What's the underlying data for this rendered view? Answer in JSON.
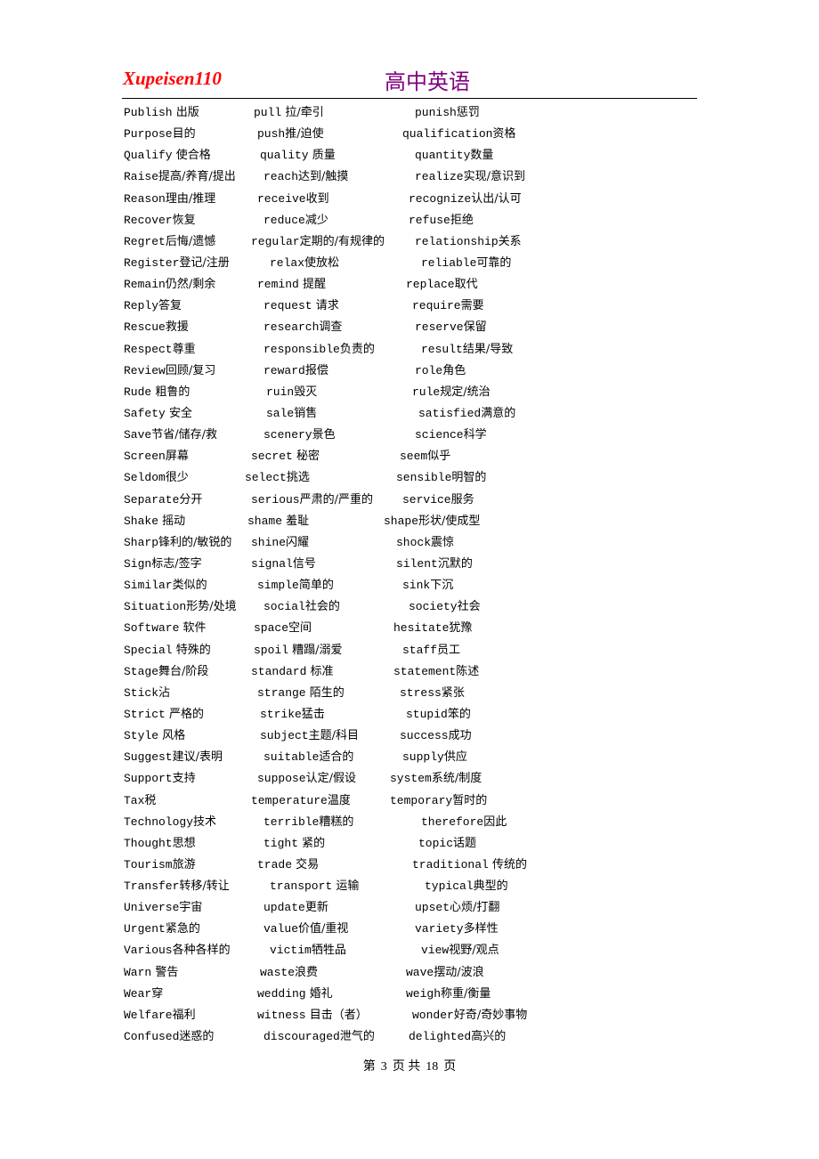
{
  "header": {
    "left_title": "Xupeisen110",
    "center_title": "高中英语"
  },
  "colors": {
    "left_title": "#ff0000",
    "center_title": "#800080",
    "text": "#000000"
  },
  "vocabulary_rows": [
    [
      {
        "en": "Publish",
        "cn": " 出版"
      },
      {
        "en": "pull",
        "cn": " 拉/牵引"
      },
      {
        "en": "punish",
        "cn": "惩罚"
      }
    ],
    [
      {
        "en": "Purpose",
        "cn": "目的"
      },
      {
        "en": "push",
        "cn": "推/迫使"
      },
      {
        "en": "qualification",
        "cn": "资格"
      }
    ],
    [
      {
        "en": "Qualify",
        "cn": " 使合格"
      },
      {
        "en": "quality",
        "cn": " 质量"
      },
      {
        "en": "quantity",
        "cn": "数量"
      }
    ],
    [
      {
        "en": "Raise",
        "cn": "提高/养育/提出"
      },
      {
        "en": "reach",
        "cn": "达到/触摸"
      },
      {
        "en": "realize",
        "cn": "实现/意识到"
      }
    ],
    [
      {
        "en": "Reason",
        "cn": "理由/推理"
      },
      {
        "en": "receive",
        "cn": "收到"
      },
      {
        "en": "recognize",
        "cn": "认出/认可"
      }
    ],
    [
      {
        "en": "Recover",
        "cn": "恢复"
      },
      {
        "en": "reduce",
        "cn": "减少"
      },
      {
        "en": "refuse",
        "cn": "拒绝"
      }
    ],
    [
      {
        "en": "Regret",
        "cn": "后悔/遗憾"
      },
      {
        "en": "regular",
        "cn": "定期的/有规律的"
      },
      {
        "en": "relationship",
        "cn": "关系"
      }
    ],
    [
      {
        "en": "Register",
        "cn": "登记/注册"
      },
      {
        "en": "relax",
        "cn": "使放松"
      },
      {
        "en": "reliable",
        "cn": "可靠的"
      }
    ],
    [
      {
        "en": "Remain",
        "cn": "仍然/剩余"
      },
      {
        "en": "remind",
        "cn": " 提醒"
      },
      {
        "en": "replace",
        "cn": "取代"
      }
    ],
    [
      {
        "en": "Reply",
        "cn": "答复"
      },
      {
        "en": "request",
        "cn": " 请求"
      },
      {
        "en": "require",
        "cn": "需要"
      }
    ],
    [
      {
        "en": "Rescue",
        "cn": "救援"
      },
      {
        "en": "research",
        "cn": "调查"
      },
      {
        "en": "reserve",
        "cn": "保留"
      }
    ],
    [
      {
        "en": "Respect",
        "cn": "尊重"
      },
      {
        "en": "responsible",
        "cn": "负责的"
      },
      {
        "en": "result",
        "cn": "结果/导致"
      }
    ],
    [
      {
        "en": "Review",
        "cn": "回顾/复习"
      },
      {
        "en": "reward",
        "cn": "报偿"
      },
      {
        "en": "role",
        "cn": "角色"
      }
    ],
    [
      {
        "en": "Rude",
        "cn": " 粗鲁的"
      },
      {
        "en": "ruin",
        "cn": "毁灭"
      },
      {
        "en": "rule",
        "cn": "规定/统治"
      }
    ],
    [
      {
        "en": "Safety",
        "cn": " 安全"
      },
      {
        "en": "sale",
        "cn": "销售"
      },
      {
        "en": "satisfied",
        "cn": "满意的"
      }
    ],
    [
      {
        "en": "Save",
        "cn": "节省/储存/救"
      },
      {
        "en": "scenery",
        "cn": "景色"
      },
      {
        "en": "science",
        "cn": "科学"
      }
    ],
    [
      {
        "en": "Screen",
        "cn": "屏幕"
      },
      {
        "en": "secret",
        "cn": " 秘密"
      },
      {
        "en": "seem",
        "cn": "似乎"
      }
    ],
    [
      {
        "en": "Seldom",
        "cn": "很少"
      },
      {
        "en": "select",
        "cn": "挑选"
      },
      {
        "en": "sensible",
        "cn": "明智的"
      }
    ],
    [
      {
        "en": "Separate",
        "cn": "分开"
      },
      {
        "en": "serious",
        "cn": "严肃的/严重的"
      },
      {
        "en": "service",
        "cn": "服务"
      }
    ],
    [
      {
        "en": "Shake",
        "cn": " 摇动"
      },
      {
        "en": "shame",
        "cn": " 羞耻"
      },
      {
        "en": "shape",
        "cn": "形状/使成型"
      }
    ],
    [
      {
        "en": "Sharp",
        "cn": "锋利的/敏锐的"
      },
      {
        "en": "shine",
        "cn": "闪耀"
      },
      {
        "en": "shock",
        "cn": "震惊"
      }
    ],
    [
      {
        "en": "Sign",
        "cn": "标志/签字"
      },
      {
        "en": "signal",
        "cn": "信号"
      },
      {
        "en": "silent",
        "cn": "沉默的"
      }
    ],
    [
      {
        "en": "Similar",
        "cn": "类似的"
      },
      {
        "en": "simple",
        "cn": "简单的"
      },
      {
        "en": "sink",
        "cn": "下沉"
      }
    ],
    [
      {
        "en": "Situation",
        "cn": "形势/处境"
      },
      {
        "en": "social",
        "cn": "社会的"
      },
      {
        "en": "society",
        "cn": "社会"
      }
    ],
    [
      {
        "en": "Software",
        "cn": " 软件"
      },
      {
        "en": "space",
        "cn": "空间"
      },
      {
        "en": "hesitate",
        "cn": "犹豫"
      }
    ],
    [
      {
        "en": "Special",
        "cn": " 特殊的"
      },
      {
        "en": "spoil",
        "cn": " 糟蹋/溺爱"
      },
      {
        "en": "staff",
        "cn": "员工"
      }
    ],
    [
      {
        "en": "Stage",
        "cn": "舞台/阶段"
      },
      {
        "en": "standard",
        "cn": " 标准"
      },
      {
        "en": "statement",
        "cn": "陈述"
      }
    ],
    [
      {
        "en": "Stick",
        "cn": "沾"
      },
      {
        "en": "strange",
        "cn": " 陌生的"
      },
      {
        "en": "stress",
        "cn": "紧张"
      }
    ],
    [
      {
        "en": "Strict",
        "cn": " 严格的"
      },
      {
        "en": "strike",
        "cn": "猛击"
      },
      {
        "en": "stupid",
        "cn": "笨的"
      }
    ],
    [
      {
        "en": "Style",
        "cn": " 风格"
      },
      {
        "en": "subject",
        "cn": "主题/科目"
      },
      {
        "en": "success",
        "cn": "成功"
      }
    ],
    [
      {
        "en": "Suggest",
        "cn": "建议/表明"
      },
      {
        "en": "suitable",
        "cn": "适合的"
      },
      {
        "en": "supply",
        "cn": "供应"
      }
    ],
    [
      {
        "en": "Support",
        "cn": "支持"
      },
      {
        "en": "suppose",
        "cn": "认定/假设"
      },
      {
        "en": "system",
        "cn": "系统/制度"
      }
    ],
    [
      {
        "en": "Tax",
        "cn": "税"
      },
      {
        "en": "temperature",
        "cn": "温度"
      },
      {
        "en": "temporary",
        "cn": "暂时的"
      }
    ],
    [
      {
        "en": "Technology",
        "cn": "技术"
      },
      {
        "en": "terrible",
        "cn": "糟糕的"
      },
      {
        "en": "therefore",
        "cn": "因此"
      }
    ],
    [
      {
        "en": "Thought",
        "cn": "思想"
      },
      {
        "en": "tight",
        "cn": " 紧的"
      },
      {
        "en": "topic",
        "cn": "话题"
      }
    ],
    [
      {
        "en": "Tourism",
        "cn": "旅游"
      },
      {
        "en": "trade",
        "cn": " 交易"
      },
      {
        "en": "traditional",
        "cn": " 传统的"
      }
    ],
    [
      {
        "en": "Transfer",
        "cn": "转移/转让"
      },
      {
        "en": "transport",
        "cn": " 运输"
      },
      {
        "en": "typical",
        "cn": "典型的"
      }
    ],
    [
      {
        "en": "Universe",
        "cn": "宇宙"
      },
      {
        "en": "update",
        "cn": "更新"
      },
      {
        "en": "upset",
        "cn": "心烦/打翻"
      }
    ],
    [
      {
        "en": "Urgent",
        "cn": "紧急的"
      },
      {
        "en": "value",
        "cn": "价值/重视"
      },
      {
        "en": "variety",
        "cn": "多样性"
      }
    ],
    [
      {
        "en": "Various",
        "cn": "各种各样的"
      },
      {
        "en": "victim",
        "cn": "牺牲品"
      },
      {
        "en": "view",
        "cn": "视野/观点"
      }
    ],
    [
      {
        "en": "Warn",
        "cn": " 警告"
      },
      {
        "en": "waste",
        "cn": "浪费"
      },
      {
        "en": "wave",
        "cn": "摆动/波浪"
      }
    ],
    [
      {
        "en": "Wear",
        "cn": "穿"
      },
      {
        "en": "wedding",
        "cn": " 婚礼"
      },
      {
        "en": "weigh",
        "cn": "称重/衡量"
      }
    ],
    [
      {
        "en": "Welfare",
        "cn": "福利"
      },
      {
        "en": "witness",
        "cn": " 目击（者）"
      },
      {
        "en": "wonder",
        "cn": "好奇/奇妙事物"
      }
    ],
    [
      {
        "en": "Confused",
        "cn": "迷惑的"
      },
      {
        "en": "discouraged",
        "cn": "泄气的"
      },
      {
        "en": "delighted",
        "cn": "高兴的"
      }
    ]
  ],
  "footer": {
    "prefix": "第",
    "current_page": "3",
    "middle": "页 共",
    "total_pages": "18",
    "suffix": "页"
  }
}
